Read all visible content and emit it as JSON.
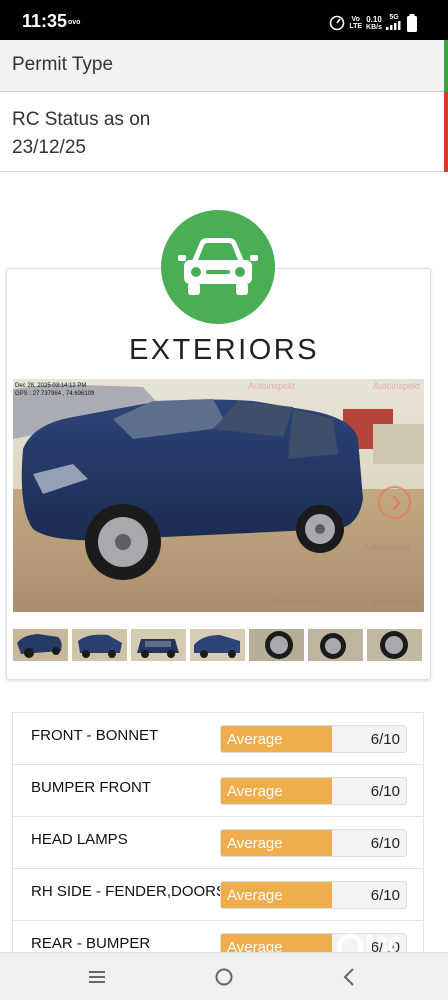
{
  "status_bar": {
    "time": "11:35",
    "carrier": "ovo",
    "volte_top": "Vo",
    "volte_bottom": "LTE",
    "speed_value": "0.10",
    "speed_unit": "KB/s",
    "network": "5G"
  },
  "rows": {
    "permit_type_label": "Permit Type",
    "rc_status_label": "RC Status as on 23/12/25"
  },
  "section": {
    "icon": "car-icon",
    "title": "EXTERIORS",
    "accent_color": "#4aae56"
  },
  "gallery": {
    "timestamp_line1": "Dec 28, 2025 03:14:12 PM",
    "timestamp_line2": "GPS : 27.737964 , 74.696109",
    "watermark": "Autoinspekt",
    "thumbnail_count": 7
  },
  "inspection_items": [
    {
      "label": "FRONT - BONNET",
      "rating": "Average",
      "score": "6/10",
      "fraction": 0.6
    },
    {
      "label": "BUMPER FRONT",
      "rating": "Average",
      "score": "6/10",
      "fraction": 0.6
    },
    {
      "label": "HEAD LAMPS",
      "rating": "Average",
      "score": "6/10",
      "fraction": 0.6
    },
    {
      "label": "RH SIDE - FENDER,DOORS",
      "rating": "Average",
      "score": "6/10",
      "fraction": 0.6
    },
    {
      "label": "REAR - BUMPER",
      "rating": "Average",
      "score": "6/10",
      "fraction": 0.6
    }
  ],
  "colors": {
    "rating_average": "#f0ad4e",
    "status_green": "#3aa244",
    "status_red": "#d33c2c"
  },
  "nav": {
    "recent_apps": "menu-icon",
    "home": "home-icon",
    "back": "back-icon"
  },
  "olx_logo_text": "OLX"
}
